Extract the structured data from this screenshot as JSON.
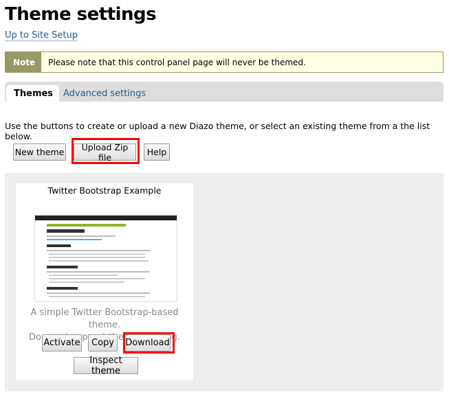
{
  "page": {
    "title": "Theme settings",
    "up_link": "Up to Site Setup"
  },
  "note": {
    "label": "Note",
    "text": "Please note that this control panel page will never be themed."
  },
  "tabs": [
    {
      "label": "Themes",
      "active": true
    },
    {
      "label": "Advanced settings",
      "active": false
    }
  ],
  "description": "Use the buttons to create or upload a new Diazo theme, or select an existing theme from a the list below.",
  "toolbar": {
    "new_theme": "New theme",
    "upload_zip": "Upload Zip file",
    "help": "Help"
  },
  "themes": [
    {
      "title": "Twitter Bootstrap Example",
      "description": "A simple Twitter Bootstrap-based theme.",
      "note": "Does not support themed editing.",
      "actions": {
        "activate": "Activate",
        "copy": "Copy",
        "download": "Download",
        "inspect": "Inspect theme"
      }
    }
  ],
  "colors": {
    "link": "#205c90",
    "note_label": "#999966",
    "note_bg": "#ffffe3",
    "highlight": "#ff0000",
    "thumb_accent": "#8db526"
  }
}
